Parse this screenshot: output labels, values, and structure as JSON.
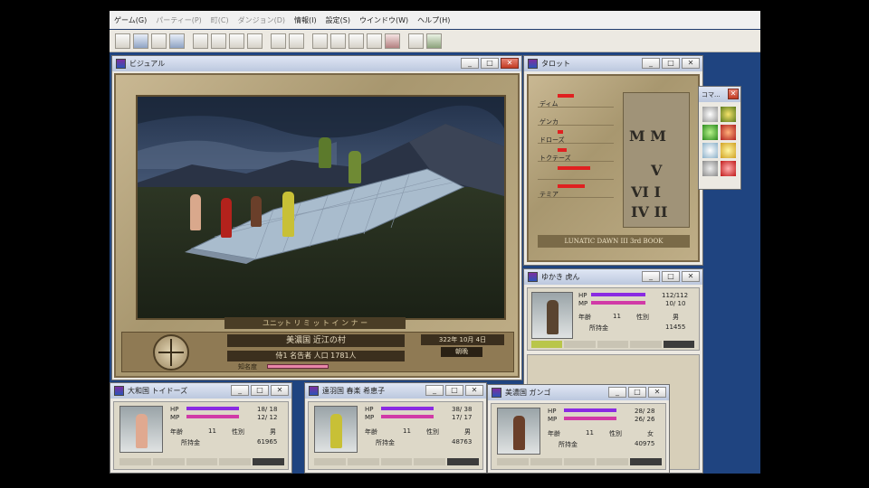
{
  "menu": {
    "items": [
      "ゲーム(G)",
      "パーティー(P)",
      "町(C)",
      "ダンジョン(D)",
      "情報(I)",
      "設定(S)",
      "ウインドウ(W)",
      "ヘルプ(H)"
    ],
    "dim_items": [
      1,
      2,
      3
    ]
  },
  "visual_window": {
    "title": "ビジュアル",
    "location_name": "美濃国 近江の村",
    "date_text": "322年 10月 4日",
    "time_text": "朝晩",
    "info_line": "侍1 名告者   人口 1781人",
    "fame_label": "知名度",
    "banner_text": "ユニット リ ミ ッ ト イ ン ナ ー"
  },
  "tarot_window": {
    "title": "タロット",
    "party_names": [
      "ディム",
      "ゲンカ",
      "ドローズ",
      "",
      "トクテーズ",
      "",
      "テミア"
    ],
    "cards_top": "M M",
    "cards_mid": "V",
    "cards_row3": "VI I",
    "cards_row4": "IV II",
    "book_title": "LUNATIC DAWN III 3rd BOOK"
  },
  "command_window": {
    "title": "コマ..."
  },
  "status_main": {
    "title": "ゆかき 虎ん",
    "hp_label": "HP",
    "mp_label": "MP",
    "hp_text": "112/112",
    "mp_text": "10/ 10",
    "age_label": "年齢",
    "age": "11",
    "sex_label": "性別",
    "sex": "男",
    "money_label": "所持金",
    "money": "11455"
  },
  "status_cards": [
    {
      "title": "大和国 トイドーズ",
      "hp_label": "HP",
      "mp_label": "MP",
      "hp_text": "18/ 18",
      "mp_text": "12/ 12",
      "age_label": "年齢",
      "age": "11",
      "sex_label": "性別",
      "sex": "男",
      "money_label": "所持金",
      "money": "61965"
    },
    {
      "title": "遠羽国 春楽 希恵子",
      "hp_label": "HP",
      "mp_label": "MP",
      "hp_text": "38/ 38",
      "mp_text": "17/ 17",
      "age_label": "年齢",
      "age": "11",
      "sex_label": "性別",
      "sex": "男",
      "money_label": "所持金",
      "money": "48763"
    },
    {
      "title": "美濃国 ガンゴ",
      "hp_label": "HP",
      "mp_label": "MP",
      "hp_text": "28/ 28",
      "mp_text": "26/ 26",
      "age_label": "年齢",
      "age": "11",
      "sex_label": "性別",
      "sex": "女",
      "money_label": "所持金",
      "money": "40975"
    }
  ],
  "colors": {
    "desktop": "#1f4480",
    "hp_bar": "#8a2be2",
    "mp_bar": "#d13aa7",
    "tarot_bar": "#e02020"
  }
}
